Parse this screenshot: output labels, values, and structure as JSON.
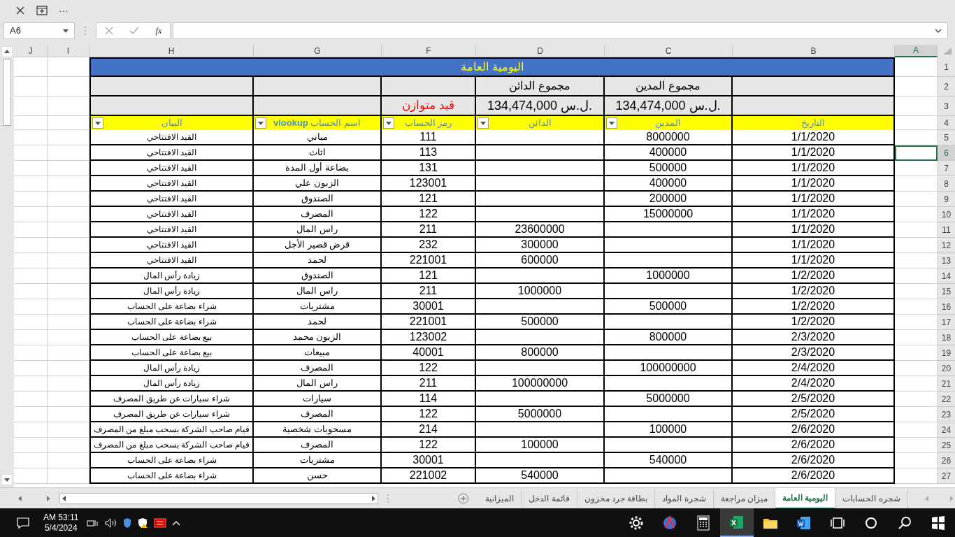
{
  "toolbar": {
    "more": "···"
  },
  "name_box": "A6",
  "formula_bar": {
    "fx": "fx"
  },
  "columns": [
    {
      "label": "A",
      "selected": true
    },
    {
      "label": "B",
      "selected": false
    },
    {
      "label": "C",
      "selected": false
    },
    {
      "label": "D",
      "selected": false
    },
    {
      "label": "F",
      "selected": false
    },
    {
      "label": "G",
      "selected": false
    },
    {
      "label": "H",
      "selected": false
    },
    {
      "label": "I",
      "selected": false
    },
    {
      "label": "J",
      "selected": false
    }
  ],
  "header_row_numbers": [
    "1",
    "2",
    "3",
    "4"
  ],
  "title": "اليومية العامة",
  "totals": {
    "credit_label": "مجموع الدائن",
    "debit_label": "مجموع المدين",
    "balance_status": "قيد متوازن",
    "credit_total": "134,474,000 ل.س.",
    "debit_total": "134,474,000 ل.س."
  },
  "table": {
    "columns": [
      {
        "label": "التاريخ",
        "filter_button": false
      },
      {
        "label": "المدين",
        "filter_button": true
      },
      {
        "label": "الدائن",
        "filter_button": true
      },
      {
        "label": "رمز الحساب",
        "filter_button": true
      },
      {
        "label": "اسم الحساب **vlookup**",
        "filter_button": true
      },
      {
        "label": "البيان",
        "filter_button": true
      }
    ],
    "rows": [
      {
        "number": "5",
        "date": "1/1/2020",
        "debit": "8000000",
        "code": "111",
        "account": "مباني",
        "description": "القيد الافتتاحي",
        "selected": false
      },
      {
        "number": "6",
        "date": "1/1/2020",
        "debit": "400000",
        "code": "113",
        "account": "اثاث",
        "description": "القيد الافتتاحي",
        "selected": true
      },
      {
        "number": "7",
        "date": "1/1/2020",
        "debit": "500000",
        "code": "131",
        "account": "بضاعة أول المدة",
        "description": "القيد الافتتاحي",
        "selected": false
      },
      {
        "number": "8",
        "date": "1/1/2020",
        "debit": "400000",
        "code": "123001",
        "account": "الزبون علي",
        "description": "القيد الافتتاحي",
        "selected": false
      },
      {
        "number": "9",
        "date": "1/1/2020",
        "debit": "200000",
        "code": "121",
        "account": "الصندوق",
        "description": "القيد الافتتاحي",
        "selected": false
      },
      {
        "number": "10",
        "date": "1/1/2020",
        "debit": "15000000",
        "code": "122",
        "account": "المصرف",
        "description": "القيد الافتتاحي",
        "selected": false
      },
      {
        "number": "11",
        "date": "1/1/2020",
        "credit": "23600000",
        "code": "211",
        "account": "راس المال",
        "description": "القيد الافتتاحي",
        "selected": false
      },
      {
        "number": "12",
        "date": "1/1/2020",
        "credit": "300000",
        "code": "232",
        "account": "قرض قصير الأجل",
        "description": "القيد الافتتاحي",
        "selected": false
      },
      {
        "number": "13",
        "date": "1/1/2020",
        "credit": "600000",
        "code": "221001",
        "account": "لحمد",
        "description": "القيد الافتتاحي",
        "selected": false
      },
      {
        "number": "14",
        "date": "1/2/2020",
        "debit": "1000000",
        "code": "121",
        "account": "الصندوق",
        "description": "زيادة رأس المال",
        "selected": false
      },
      {
        "number": "15",
        "date": "1/2/2020",
        "credit": "1000000",
        "code": "211",
        "account": "راس المال",
        "description": "زيادة رأس المال",
        "selected": false
      },
      {
        "number": "16",
        "date": "1/2/2020",
        "debit": "500000",
        "code": "30001",
        "account": "مشتريات",
        "description": "شراء بضاعة على الحساب",
        "selected": false
      },
      {
        "number": "17",
        "date": "1/2/2020",
        "credit": "500000",
        "code": "221001",
        "account": "لحمد",
        "description": "شراء بضاعة على الحساب",
        "selected": false
      },
      {
        "number": "18",
        "date": "2/3/2020",
        "debit": "800000",
        "code": "123002",
        "account": "الزبون محمد",
        "description": "بيع بضاعة على الحساب",
        "selected": false
      },
      {
        "number": "19",
        "date": "2/3/2020",
        "credit": "800000",
        "code": "40001",
        "account": "مبيعات",
        "description": "بيع بضاعة على الحساب",
        "selected": false
      },
      {
        "number": "20",
        "date": "2/4/2020",
        "debit": "100000000",
        "code": "122",
        "account": "المصرف",
        "description": "زيادة رأس المال",
        "selected": false
      },
      {
        "number": "21",
        "date": "2/4/2020",
        "credit": "100000000",
        "code": "211",
        "account": "راس المال",
        "description": "زيادة رأس المال",
        "selected": false
      },
      {
        "number": "22",
        "date": "2/5/2020",
        "debit": "5000000",
        "code": "114",
        "account": "سيارات",
        "description": "شراء سيارات عن طريق المصرف",
        "selected": false
      },
      {
        "number": "23",
        "date": "2/5/2020",
        "credit": "5000000",
        "code": "122",
        "account": "المصرف",
        "description": "شراء سيارات عن طريق المصرف",
        "selected": false
      },
      {
        "number": "24",
        "date": "2/6/2020",
        "debit": "100000",
        "code": "214",
        "account": "مسحوبات شخصية",
        "description": "قيام صاحب الشركة بسحب مبلغ من المصرف",
        "selected": false
      },
      {
        "number": "25",
        "date": "2/6/2020",
        "credit": "100000",
        "code": "122",
        "account": "المصرف",
        "description": "قيام صاحب الشركة بسحب مبلغ من المصرف",
        "selected": false
      },
      {
        "number": "26",
        "date": "2/6/2020",
        "debit": "540000",
        "code": "30001",
        "account": "مشتريات",
        "description": "شراء بضاعة على الحساب",
        "selected": false
      },
      {
        "number": "27",
        "date": "2/6/2020",
        "credit": "540000",
        "code": "221002",
        "account": "حسن",
        "description": "شراء بضاعة على الحساب",
        "selected": false
      }
    ]
  },
  "sheet_tabs": [
    {
      "label": "شجره الحسابات",
      "selected": false
    },
    {
      "label": "اليومية العامة",
      "selected": true
    },
    {
      "label": "ميزان مراجعة",
      "selected": false
    },
    {
      "label": "شجرة المواد",
      "selected": false
    },
    {
      "label": "بطاقة جرد مخزون",
      "selected": false
    },
    {
      "label": "قائمة الدخل",
      "selected": false
    },
    {
      "label": "الميزانية",
      "selected": false
    }
  ],
  "taskbar": {
    "time": "AM 53:11",
    "date": "5/4/2024",
    "apps": [
      {
        "kind": "settings",
        "active": false
      },
      {
        "kind": "app",
        "active": false
      },
      {
        "kind": "calculator",
        "active": false
      },
      {
        "kind": "excel",
        "active": true
      },
      {
        "kind": "folder",
        "active": false
      },
      {
        "kind": "word",
        "active": false
      },
      {
        "kind": "taskview",
        "active": false
      },
      {
        "kind": "cortana",
        "active": false
      },
      {
        "kind": "search",
        "active": false
      },
      {
        "kind": "windows",
        "active": false
      }
    ]
  }
}
